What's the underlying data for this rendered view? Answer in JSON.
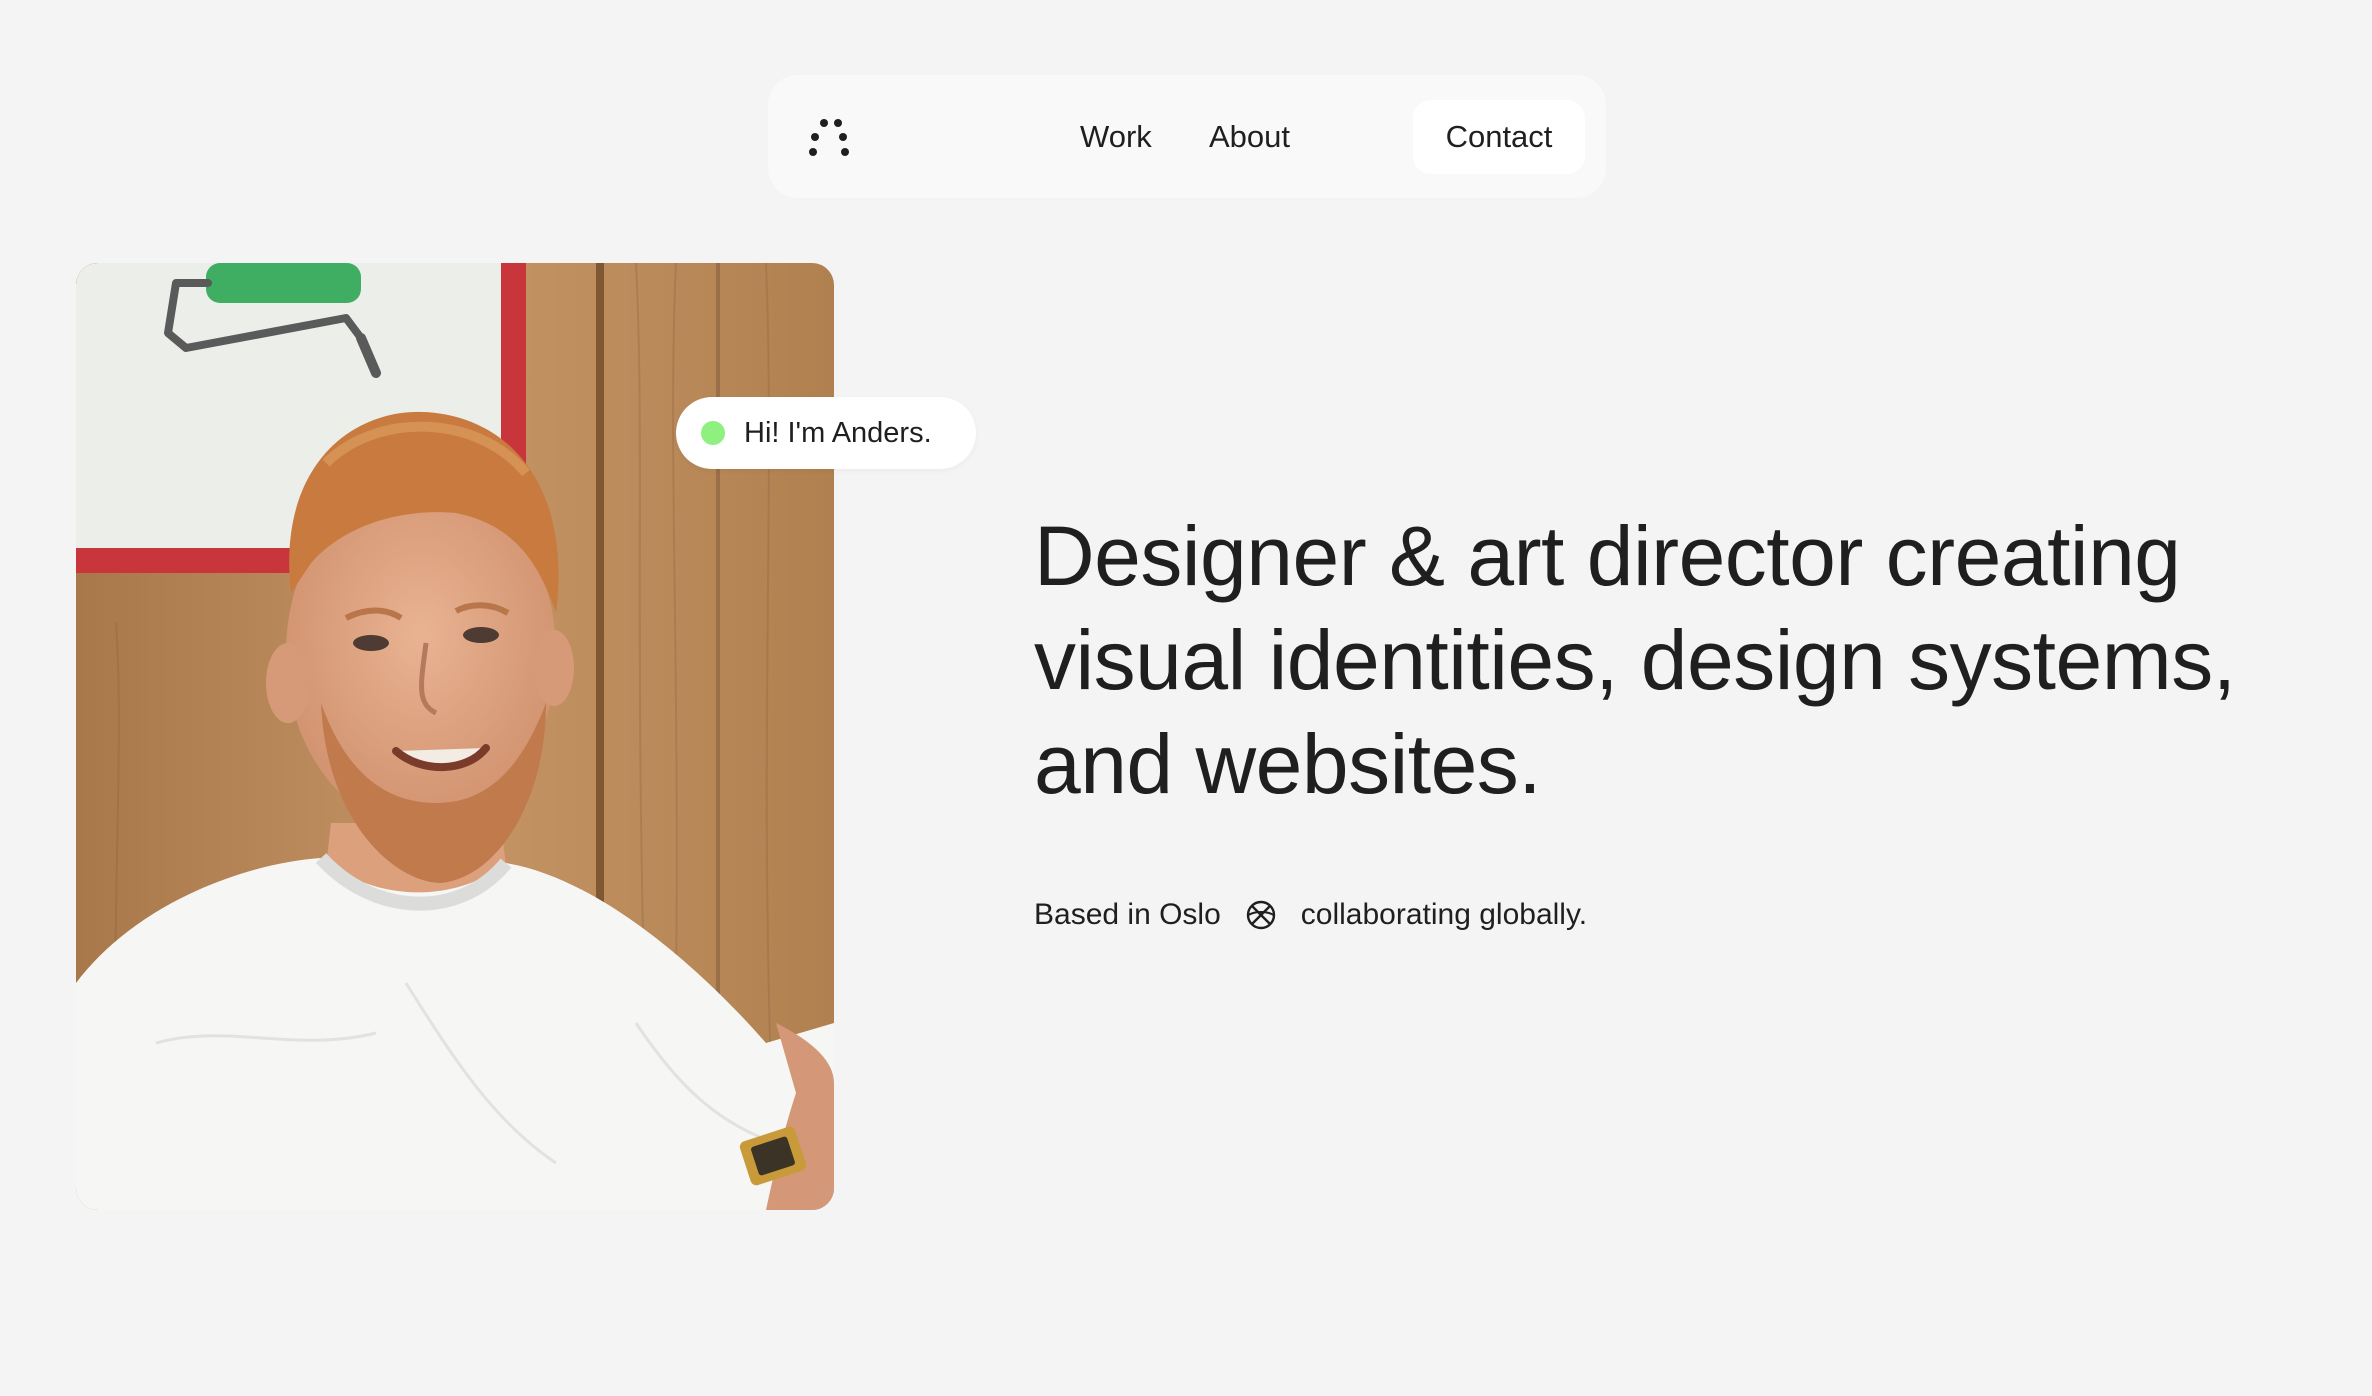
{
  "nav": {
    "logo_icon": "dots-logo-icon",
    "links": [
      {
        "label": "Work"
      },
      {
        "label": "About"
      }
    ],
    "contact_label": "Contact"
  },
  "hero": {
    "photo_icon": "portrait-photo",
    "greeting": "Hi! I'm Anders.",
    "status_color": "#8ef07f",
    "headline_lines": [
      "Designer & art director creating",
      "visual identities, design systems,",
      "and websites."
    ],
    "location_left": "Based in Oslo",
    "location_icon": "globe-icon",
    "location_right": "collaborating globally."
  },
  "colors": {
    "background": "#f4f4f4",
    "nav_background": "#f9f9f9",
    "text": "#1f1f1f"
  }
}
